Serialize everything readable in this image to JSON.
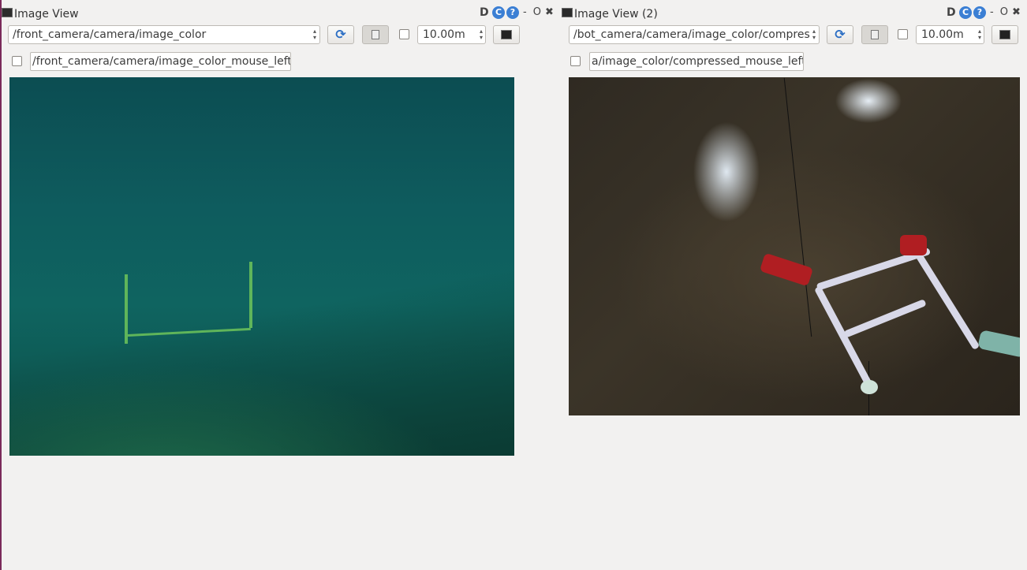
{
  "windows": [
    {
      "title": "Image View",
      "icons": {
        "d": "D",
        "refresh": "refresh-icon",
        "help": "?",
        "minimize": "-",
        "restore": "O",
        "close": "✖"
      },
      "topic_combo": "/front_camera/camera/image_color",
      "timeout_value": "10.00m",
      "mouse_topic_value": "/front_camera/camera/image_color_mouse_left",
      "image_description": "underwater scene with green gate"
    },
    {
      "title": "Image View (2)",
      "icons": {
        "d": "D",
        "refresh": "refresh-icon",
        "help": "?",
        "minimize": "-",
        "restore": "O",
        "close": "✖"
      },
      "topic_combo": "/bot_camera/camera/image_color/compres",
      "timeout_value": "10.00m",
      "mouse_topic_value": "a/image_color/compressed_mouse_left",
      "image_description": "downward camera view of pool floor with robot frame"
    }
  ],
  "glyphs": {
    "refresh": "⟳",
    "spin_arrows_up": "▲",
    "spin_arrows_down": "▼",
    "combo_up": "▴",
    "combo_down": "▾"
  }
}
